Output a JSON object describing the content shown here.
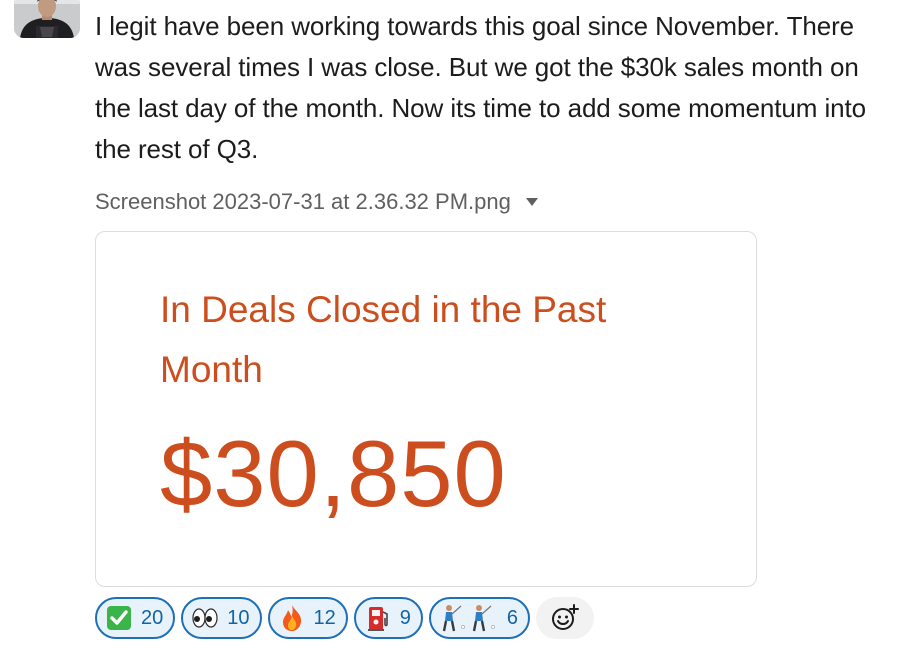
{
  "message": {
    "text": "I legit have been working towards this goal since November. There was several times I was close. But we got the $30k sales month on the last day of the month. Now its time to add some momentum into the rest of Q3."
  },
  "attachment": {
    "file_name": "Screenshot 2023-07-31 at 2.36.32 PM.png",
    "card_title": "In Deals Closed in the Past Month",
    "card_amount": "$30,850",
    "accent_color": "#cc4e1e"
  },
  "reactions": [
    {
      "emoji": "white-check-mark",
      "count": "20"
    },
    {
      "emoji": "eyes",
      "count": "10"
    },
    {
      "emoji": "fire",
      "count": "12"
    },
    {
      "emoji": "fuelpump",
      "count": "9"
    },
    {
      "emoji": "golfer",
      "count": "6"
    }
  ],
  "colors": {
    "reaction_border": "#1d6fb8",
    "reaction_bg": "#e8f2fb",
    "reaction_count": "#1264a3"
  }
}
